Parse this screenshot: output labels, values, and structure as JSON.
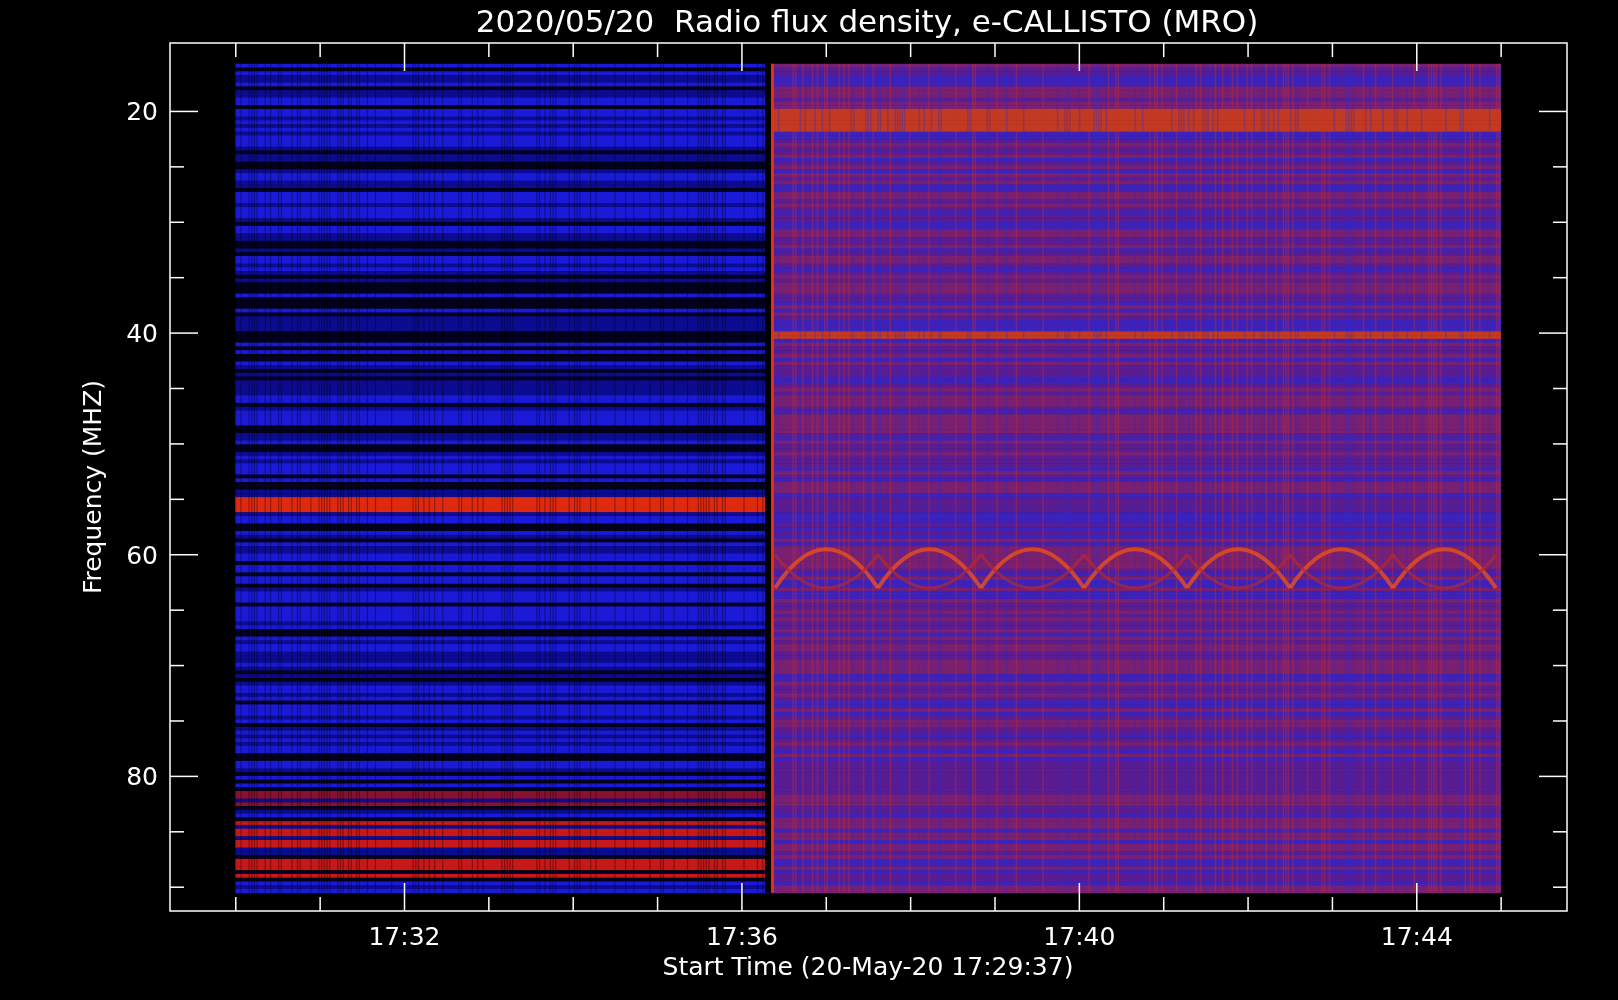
{
  "title": "2020/05/20  Radio flux density, e-CALLISTO (MRO)",
  "y_axis": {
    "label": "Frequency (MHZ)",
    "ticks": [
      "20",
      "40",
      "60",
      "80"
    ]
  },
  "x_axis": {
    "label": "Start Time (20-May-20 17:29:37)",
    "ticks": [
      "17:32",
      "17:36",
      "17:40",
      "17:44"
    ]
  }
}
